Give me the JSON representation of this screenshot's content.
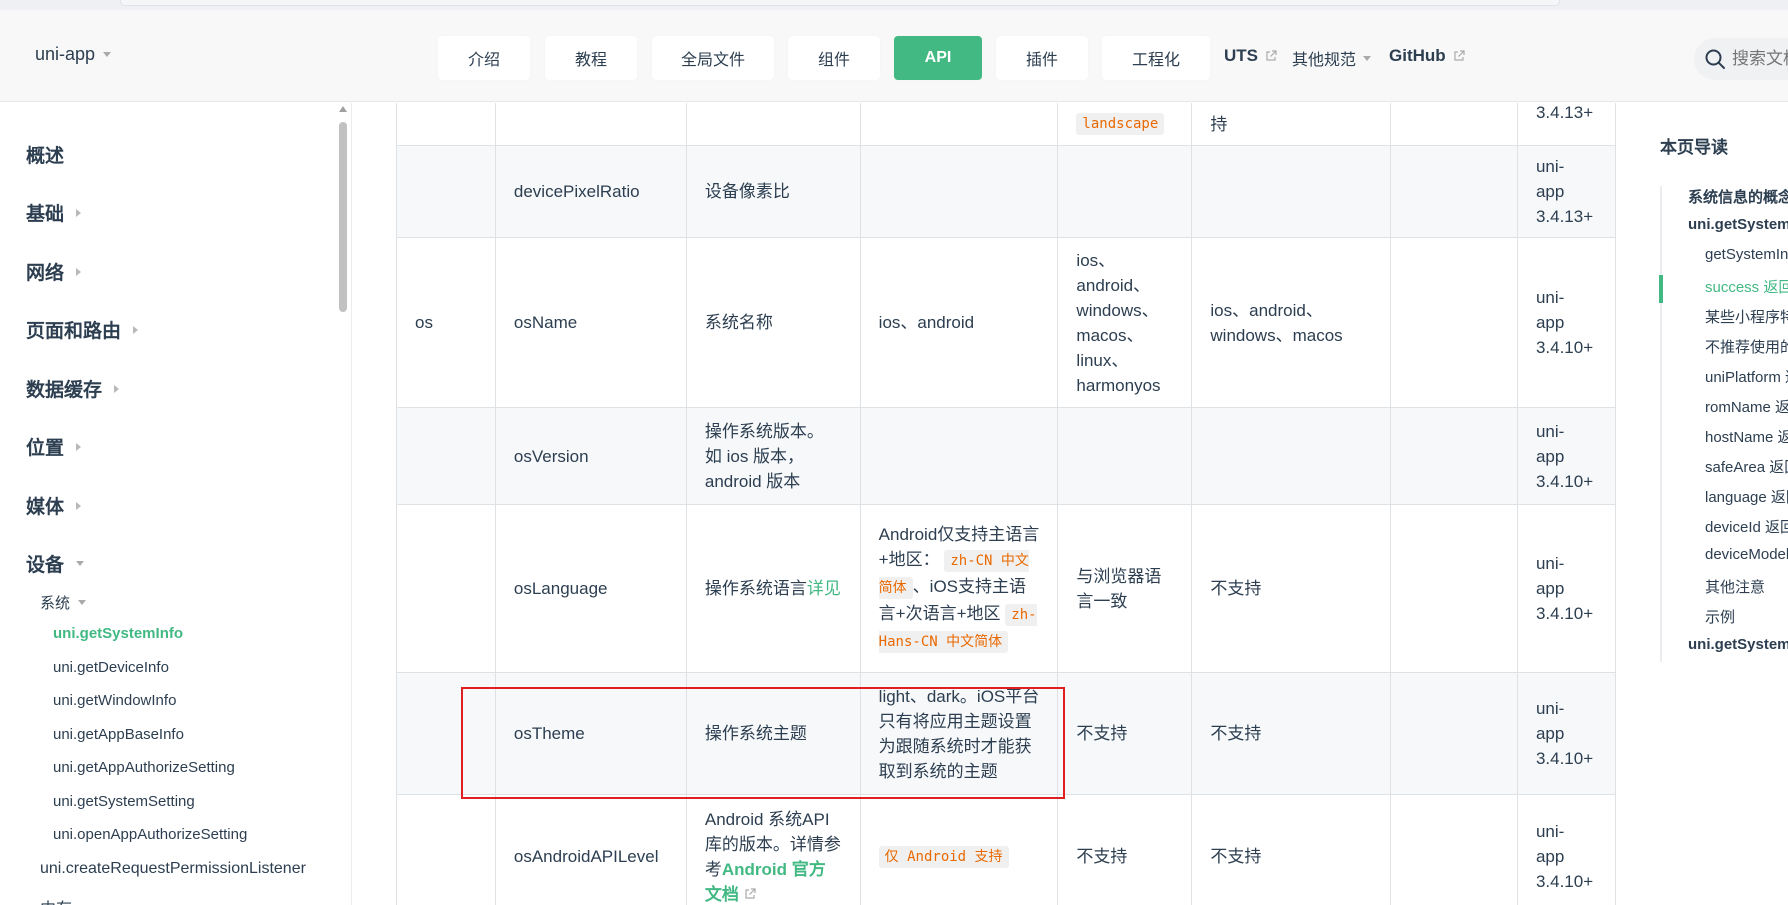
{
  "brand": {
    "name": "uni-app"
  },
  "nav": {
    "buttons": [
      {
        "label": "介绍",
        "active": false
      },
      {
        "label": "教程",
        "active": false
      },
      {
        "label": "全局文件",
        "active": false
      },
      {
        "label": "组件",
        "active": false
      },
      {
        "label": "API",
        "active": true
      },
      {
        "label": "插件",
        "active": false
      },
      {
        "label": "工程化",
        "active": false
      }
    ],
    "uts": "UTS",
    "other": "其他规范",
    "github": "GitHub"
  },
  "search": {
    "placeholder": "搜索文档"
  },
  "sidebar": {
    "groups": [
      "概述",
      "基础",
      "网络",
      "页面和路由",
      "数据缓存",
      "位置",
      "媒体",
      "设备"
    ],
    "sub": "系统",
    "items": [
      "uni.getSystemInfo",
      "uni.getDeviceInfo",
      "uni.getWindowInfo",
      "uni.getAppBaseInfo",
      "uni.getAppAuthorizeSetting",
      "uni.getSystemSetting",
      "uni.openAppAuthorizeSetting"
    ],
    "active_item": "uni.getSystemInfo",
    "extra": "uni.createRequestPermissionListener",
    "cutoff": "内存"
  },
  "table": {
    "r0": {
      "c3": "landscape",
      "c5": "持",
      "c7": "3.4.13+"
    },
    "r1": {
      "c1": "devicePixelRatio",
      "c2": "设备像素比",
      "c7a": "uni-",
      "c7b": "app",
      "c7c": "3.4.13+"
    },
    "r2": {
      "c0": "os",
      "c1": "osName",
      "c2": "系统名称",
      "c3": "ios、android",
      "c4": [
        "ios、",
        "android、",
        "windows、",
        "macos、",
        "linux、",
        "harmonyos"
      ],
      "c5a": "ios、android、",
      "c5b": "windows、macos",
      "c7a": "uni-",
      "c7b": "app",
      "c7c": "3.4.10+"
    },
    "r3": {
      "c1": "osVersion",
      "c2a": "操作系统版本。",
      "c2b": "如 ios 版本，",
      "c2c": "android 版本",
      "c7a": "uni-",
      "c7b": "app",
      "c7c": "3.4.10+"
    },
    "r4": {
      "c1": "osLanguage",
      "c2": "操作系统语言",
      "c2link": "详见",
      "c3a": "Android仅支持主语言+地区：",
      "c3code1": "zh-CN 中文简体",
      "c3b": "、iOS支持主语言+次语言+地区",
      "c3code2": "zh-Hans-CN 中文简体",
      "c4": "与浏览器语言一致",
      "c5": "不支持",
      "c7a": "uni-",
      "c7b": "app",
      "c7c": "3.4.10+"
    },
    "r5": {
      "c1": "osTheme",
      "c2": "操作系统主题",
      "c3": "light、dark。iOS平台只有将应用主题设置为跟随系统时才能获取到系统的主题",
      "c4": "不支持",
      "c5": "不支持",
      "c7a": "uni-",
      "c7b": "app",
      "c7c": "3.4.10+"
    },
    "r6": {
      "c1": "osAndroidAPILevel",
      "c2a": "Android 系统API库的版本。详情参考",
      "c2link": "Android 官方文档",
      "c3": "仅 Android 支持",
      "c4": "不支持",
      "c5": "不支持",
      "c7a": "uni-",
      "c7b": "app",
      "c7c": "3.4.10+"
    }
  },
  "toc": {
    "title": "本页导读",
    "entries": [
      {
        "text": "系统信息的概念",
        "level": 1
      },
      {
        "text": "uni.getSystemInfo",
        "level": 1
      },
      {
        "text": "getSystemInfo",
        "level": 2
      },
      {
        "text": "success 返回参数",
        "level": 2,
        "active": true
      },
      {
        "text": "某些小程序特殊",
        "level": 2
      },
      {
        "text": "不推荐使用的",
        "level": 2
      },
      {
        "text": "uniPlatform 返回",
        "level": 2
      },
      {
        "text": "romName 返回",
        "level": 2
      },
      {
        "text": "hostName 返回",
        "level": 2
      },
      {
        "text": "safeArea 返回",
        "level": 2
      },
      {
        "text": "language 返回",
        "level": 2
      },
      {
        "text": "deviceId 返回",
        "level": 2
      },
      {
        "text": "deviceModel",
        "level": 2
      },
      {
        "text": "其他注意",
        "level": 2
      },
      {
        "text": "示例",
        "level": 2
      },
      {
        "text": "uni.getSystemInfoSync",
        "level": 1
      }
    ]
  },
  "colors": {
    "accent": "#42b983",
    "highlight": "#e02020"
  }
}
